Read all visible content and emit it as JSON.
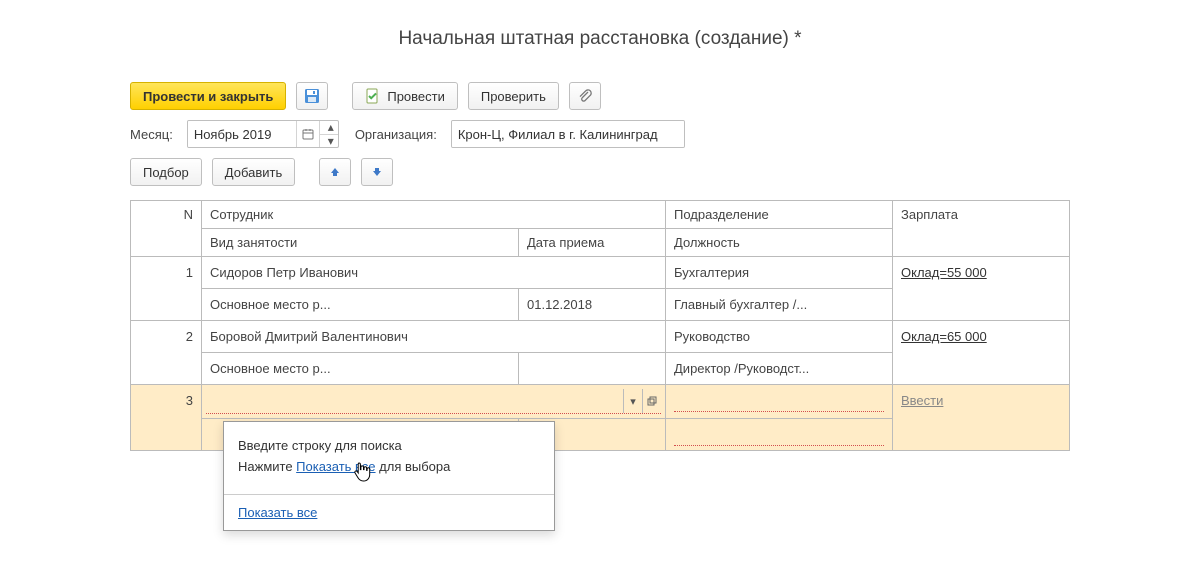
{
  "title": "Начальная штатная расстановка (создание) *",
  "toolbar": {
    "submit_close": "Провести и закрыть",
    "submit": "Провести",
    "check": "Проверить"
  },
  "filters": {
    "month_label": "Месяц:",
    "month_value": "Ноябрь 2019",
    "org_label": "Организация:",
    "org_value": "Крон-Ц, Филиал в г. Калининград"
  },
  "actions": {
    "select": "Подбор",
    "add": "Добавить"
  },
  "columns": {
    "n": "N",
    "employee": "Сотрудник",
    "job_type": "Вид занятости",
    "hire_date": "Дата приема",
    "department": "Подразделение",
    "position": "Должность",
    "salary": "Зарплата"
  },
  "rows": [
    {
      "n": "1",
      "employee": "Сидоров Петр Иванович",
      "job_type": "Основное место р...",
      "hire_date": "01.12.2018",
      "department": "Бухгалтерия",
      "position": "Главный бухгалтер /...",
      "salary": "Оклад=55 000"
    },
    {
      "n": "2",
      "employee": "Боровой Дмитрий Валентинович",
      "job_type": "Основное место р...",
      "hire_date": "",
      "department": "Руководство",
      "position": "Директор /Руководст...",
      "salary": "Оклад=65 000"
    }
  ],
  "active_row": {
    "n": "3",
    "salary_placeholder": "Ввести"
  },
  "popup": {
    "search_hint": "Введите строку для поиска",
    "select_prefix": "Нажмите ",
    "select_link": "Показать все",
    "select_suffix": " для выбора",
    "footer_link": "Показать все"
  }
}
